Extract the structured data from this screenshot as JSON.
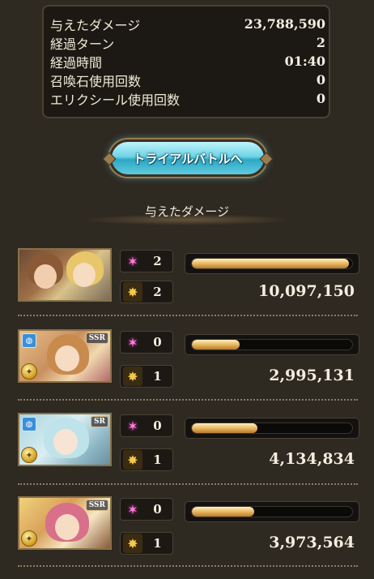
{
  "stats": [
    {
      "label": "与えたダメージ",
      "value": "23,788,590"
    },
    {
      "label": "経過ターン",
      "value": "2"
    },
    {
      "label": "経過時間",
      "value": "01:40"
    },
    {
      "label": "召喚石使用回数",
      "value": "0"
    },
    {
      "label": "エリクシール使用回数",
      "value": "0"
    }
  ],
  "trial_button": {
    "label": "トライアルバトルへ"
  },
  "section_title": "与えたダメージ",
  "icons": {
    "skill": "pink-star-icon",
    "ougi": "gold-burst-icon"
  },
  "members": [
    {
      "portrait": "main-characters-portrait",
      "rarity": "",
      "skill_count": "2",
      "ougi_count": "2",
      "damage": "10,097,150",
      "bar_fill": 0.98
    },
    {
      "portrait": "ssr-character-portrait",
      "rarity": "SSR",
      "skill_count": "0",
      "ougi_count": "1",
      "damage": "2,995,131",
      "bar_fill": 0.3
    },
    {
      "portrait": "sr-character-portrait",
      "rarity": "SR",
      "skill_count": "0",
      "ougi_count": "1",
      "damage": "4,134,834",
      "bar_fill": 0.41
    },
    {
      "portrait": "ssr-character-portrait",
      "rarity": "SSR",
      "skill_count": "0",
      "ougi_count": "1",
      "damage": "3,973,564",
      "bar_fill": 0.39
    }
  ]
}
